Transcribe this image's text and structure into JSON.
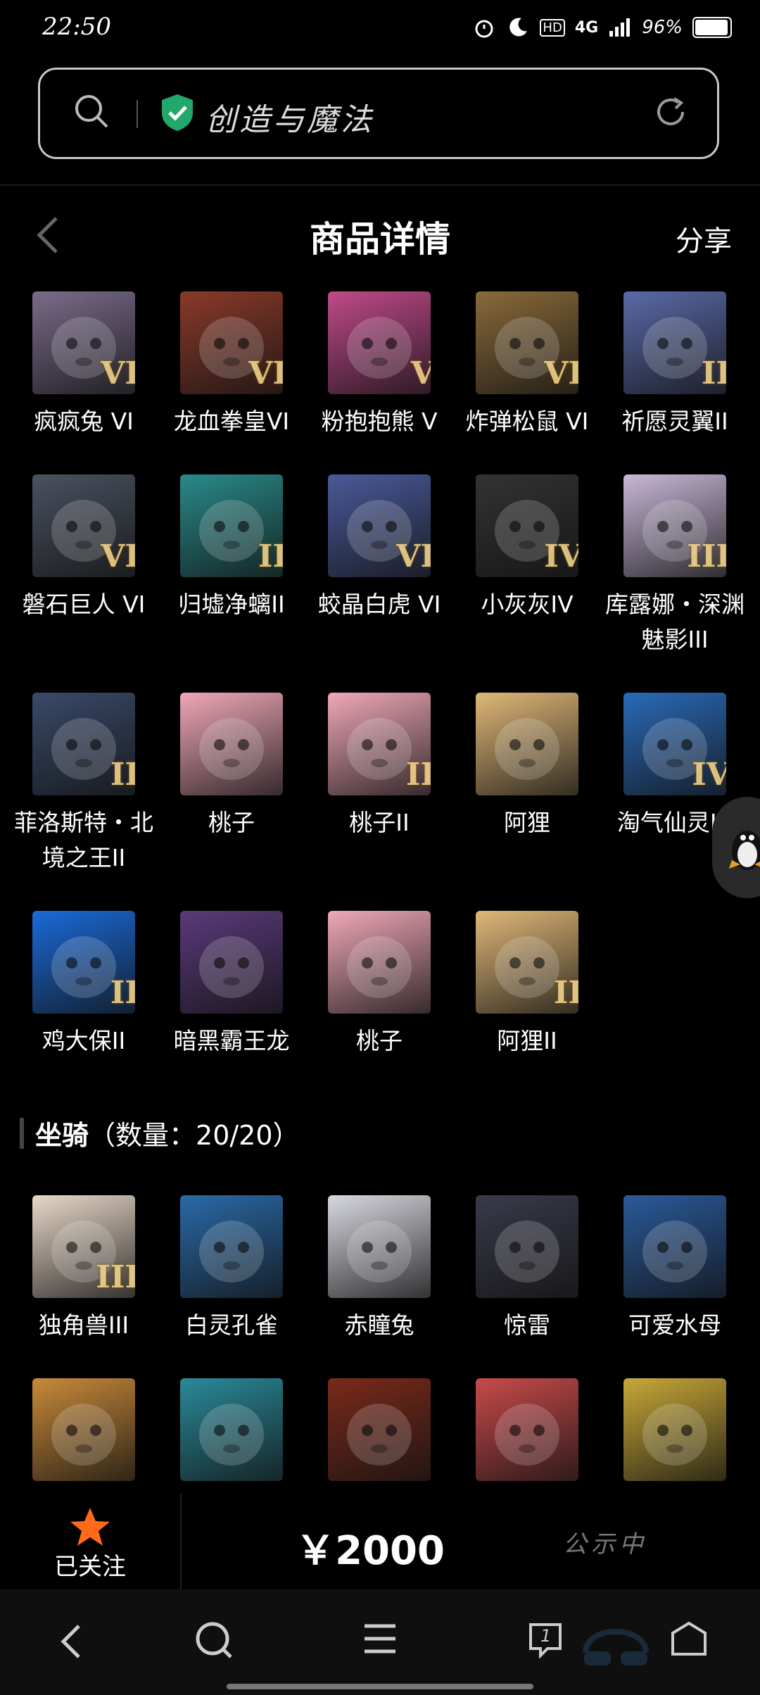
{
  "status_bar": {
    "time": "22:50",
    "network": "4G",
    "battery": "96%"
  },
  "search": {
    "query": "创造与魔法"
  },
  "header": {
    "title": "商品详情",
    "share": "分享"
  },
  "items": [
    {
      "name": "疯疯兔 VI",
      "rank": "VI",
      "color": "#7a6c8a"
    },
    {
      "name": "龙血拳皇VI",
      "rank": "VI",
      "color": "#8a3a2a"
    },
    {
      "name": "粉抱抱熊 V",
      "rank": "V",
      "color": "#c04a8a"
    },
    {
      "name": "炸弹松鼠 VI",
      "rank": "VI",
      "color": "#8a6a3a"
    },
    {
      "name": "祈愿灵翼II",
      "rank": "II",
      "color": "#5a6aa8"
    },
    {
      "name": "磐石巨人 VI",
      "rank": "VI",
      "color": "#4a5260"
    },
    {
      "name": "归墟净螭II",
      "rank": "II",
      "color": "#2a8a8a"
    },
    {
      "name": "蛟晶白虎 VI",
      "rank": "VI",
      "color": "#4a5a9a"
    },
    {
      "name": "小灰灰IV",
      "rank": "IV",
      "color": "#333333"
    },
    {
      "name": "库露娜・深渊魅影III",
      "rank": "III",
      "color": "#c8b8d8"
    },
    {
      "name": "菲洛斯特・北境之王II",
      "rank": "II",
      "color": "#3a4a6a"
    },
    {
      "name": "桃子",
      "rank": "",
      "color": "#f0a8b8"
    },
    {
      "name": "桃子II",
      "rank": "II",
      "color": "#f0a8b8"
    },
    {
      "name": "阿狸",
      "rank": "",
      "color": "#e0b878"
    },
    {
      "name": "淘气仙灵IV",
      "rank": "IV",
      "color": "#2a6ab8"
    },
    {
      "name": "鸡大保II",
      "rank": "II",
      "color": "#1a6ad8"
    },
    {
      "name": "暗黑霸王龙",
      "rank": "",
      "color": "#5a3a7a"
    },
    {
      "name": "桃子",
      "rank": "",
      "color": "#f0a8b8"
    },
    {
      "name": "阿狸II",
      "rank": "II",
      "color": "#e0b878"
    }
  ],
  "mounts_section": {
    "title": "坐骑",
    "count_label": "（数量：20/20）"
  },
  "mounts": [
    {
      "name": "独角兽III",
      "rank": "III",
      "color": "#e8d8c8"
    },
    {
      "name": "白灵孔雀",
      "rank": "",
      "color": "#2a6aa8"
    },
    {
      "name": "赤瞳兔",
      "rank": "",
      "color": "#d8d8e0"
    },
    {
      "name": "惊雷",
      "rank": "",
      "color": "#3a3a4a"
    },
    {
      "name": "可爱水母",
      "rank": "",
      "color": "#2a5a9a"
    },
    {
      "name": "",
      "rank": "",
      "color": "#c88a3a"
    },
    {
      "name": "",
      "rank": "",
      "color": "#2a8a9a"
    },
    {
      "name": "",
      "rank": "",
      "color": "#7a2a1a"
    },
    {
      "name": "",
      "rank": "",
      "color": "#c84a4a"
    },
    {
      "name": "",
      "rank": "",
      "color": "#c8a838"
    }
  ],
  "action_bar": {
    "follow_label": "已关注",
    "price": "￥2000",
    "status": "公示中"
  },
  "nav": {
    "tab_count": "1"
  }
}
